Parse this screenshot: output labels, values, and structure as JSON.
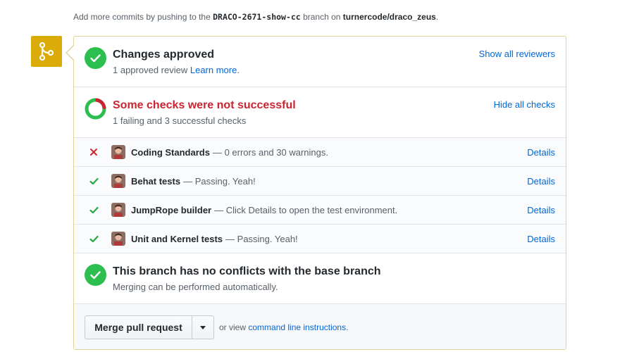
{
  "hint": {
    "prefix": "Add more commits by pushing to the",
    "branch": "DRACO-2671-show-cc",
    "middle": "branch on",
    "repo": "turnercode/draco_zeus",
    "suffix": "."
  },
  "badge_icon": "git-merge-icon",
  "colors": {
    "badge": "#dbab09",
    "success": "#2cbe4e",
    "failure": "#cb2431",
    "link": "#0366d6"
  },
  "approval": {
    "title": "Changes approved",
    "subtitle": "1 approved review",
    "learn_more": "Learn more",
    "learn_more_suffix": ".",
    "action": "Show all reviewers"
  },
  "checks_summary": {
    "title": "Some checks were not successful",
    "subtitle": "1 failing and 3 successful checks",
    "action": "Hide all checks",
    "ratio_failing": 0.25
  },
  "checks": [
    {
      "status": "failure",
      "name": "Coding Standards",
      "description": "— 0 errors and 30 warnings.",
      "details": "Details"
    },
    {
      "status": "success",
      "name": "Behat tests",
      "description": "— Passing. Yeah!",
      "details": "Details"
    },
    {
      "status": "success",
      "name": "JumpRope builder",
      "description": "— Click Details to open the test environment.",
      "details": "Details"
    },
    {
      "status": "success",
      "name": "Unit and Kernel tests",
      "description": "— Passing. Yeah!",
      "details": "Details"
    }
  ],
  "conflicts": {
    "title": "This branch has no conflicts with the base branch",
    "subtitle": "Merging can be performed automatically."
  },
  "merge": {
    "button": "Merge pull request",
    "or_view": "or view",
    "cli_link": "command line instructions",
    "cli_suffix": "."
  }
}
